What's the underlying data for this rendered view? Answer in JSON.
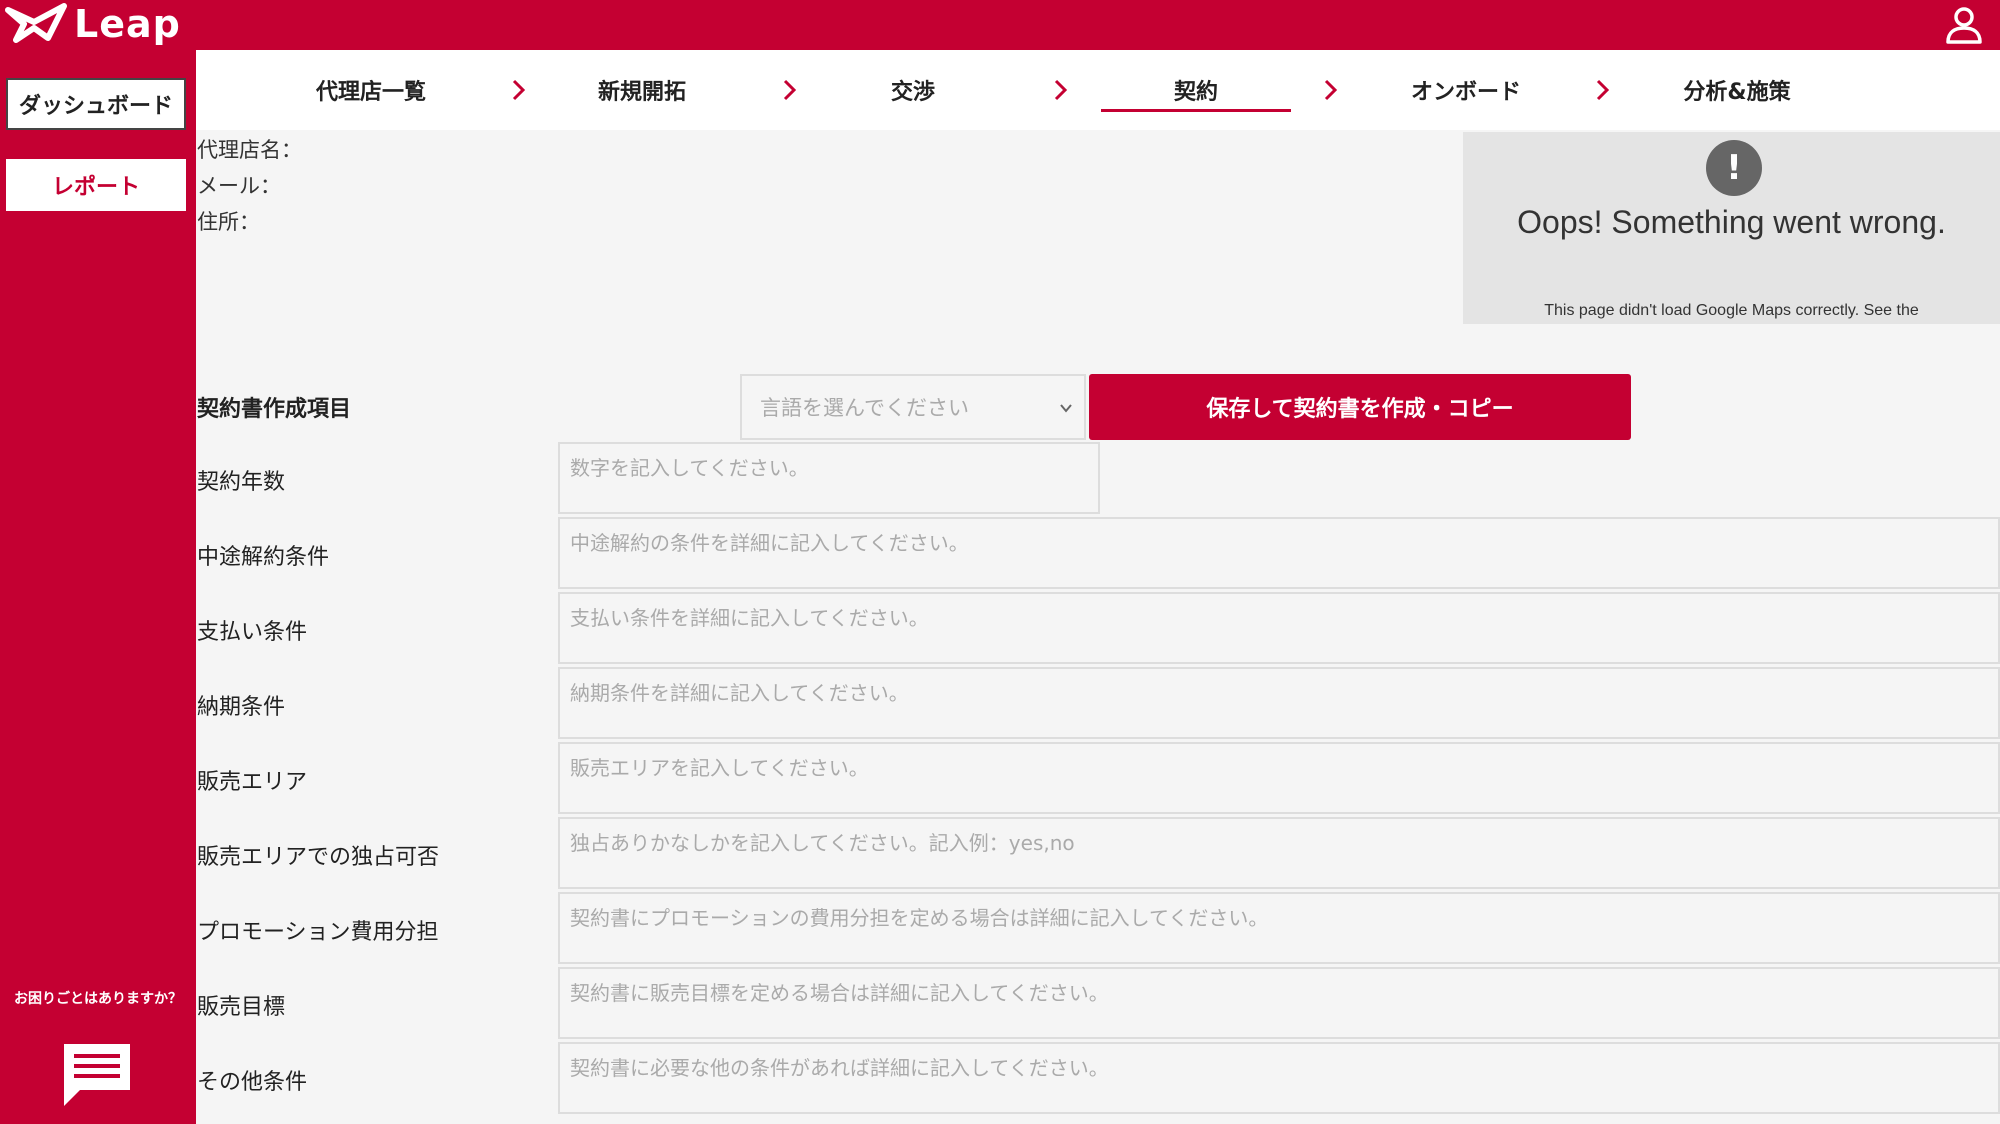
{
  "brand": {
    "name": "Leap"
  },
  "colors": {
    "primary": "#c40032"
  },
  "sidebar": {
    "dashboard_label": "ダッシュボード",
    "report_label": "レポート",
    "help_text": "お困りごとはありますか？"
  },
  "steps": [
    {
      "label": "代理店一覧",
      "active": false
    },
    {
      "label": "新規開拓",
      "active": false
    },
    {
      "label": "交渉",
      "active": false
    },
    {
      "label": "契約",
      "active": true
    },
    {
      "label": "オンボード",
      "active": false
    },
    {
      "label": "分析&施策",
      "active": false
    }
  ],
  "agency_info": {
    "name_label": "代理店名：",
    "email_label": "メール：",
    "address_label": "住所："
  },
  "map_error": {
    "title": "Oops! Something went wrong.",
    "subtitle": "This page didn't load Google Maps correctly. See the"
  },
  "contract": {
    "section_title": "契約書作成項目",
    "language_placeholder": "言語を選んでください",
    "save_button": "保存して契約書を作成・コピー",
    "fields": [
      {
        "label": "契約年数",
        "placeholder": "数字を記入してください。"
      },
      {
        "label": "中途解約条件",
        "placeholder": "中途解約の条件を詳細に記入してください。"
      },
      {
        "label": "支払い条件",
        "placeholder": "支払い条件を詳細に記入してください。"
      },
      {
        "label": "納期条件",
        "placeholder": "納期条件を詳細に記入してください。"
      },
      {
        "label": "販売エリア",
        "placeholder": "販売エリアを記入してください。"
      },
      {
        "label": "販売エリアでの独占可否",
        "placeholder": "独占ありかなしかを記入してください。記入例：yes,no"
      },
      {
        "label": "プロモーション費用分担",
        "placeholder": "契約書にプロモーションの費用分担を定める場合は詳細に記入してください。"
      },
      {
        "label": "販売目標",
        "placeholder": "契約書に販売目標を定める場合は詳細に記入してください。"
      },
      {
        "label": "その他条件",
        "placeholder": "契約書に必要な他の条件があれば詳細に記入してください。"
      }
    ]
  }
}
